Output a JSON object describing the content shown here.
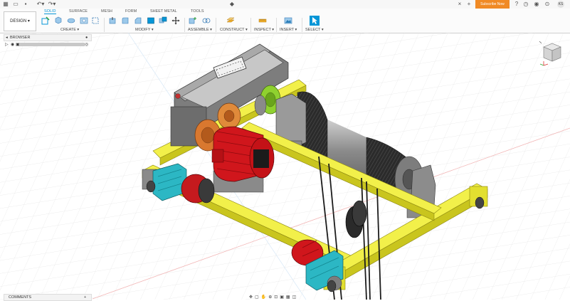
{
  "appbar": {
    "subscribe_label": "Subscribe Now",
    "user_initials": "KS"
  },
  "ribbon": {
    "workspace_label": "DESIGN ▾",
    "tabs": [
      "SOLID",
      "SURFACE",
      "MESH",
      "FORM",
      "SHEET METAL",
      "TOOLS"
    ],
    "active_tab": "SOLID",
    "groups": [
      "CREATE ▾",
      "MODIFY ▾",
      "ASSEMBLE ▾",
      "CONSTRUCT ▾",
      "INSPECT ▾",
      "INSERT ▾",
      "SELECT ▾"
    ]
  },
  "browser": {
    "title": "BROWSER"
  },
  "comments": {
    "title": "COMMENTS"
  },
  "colors": {
    "accent": "#0696d7",
    "subscribe": "#f08a24",
    "frame_yellow": "#e9e72f",
    "motor_red": "#d0161c",
    "brake_cyan": "#2cb7c4",
    "drum_dark": "#2b2b2b",
    "housing_gray": "#8a8a8a",
    "gear_orange": "#d9782f",
    "coupling_green": "#8fd12f"
  },
  "icons": [
    "pin-icon",
    "gear-icon",
    "undo-icon",
    "redo-icon",
    "close-icon",
    "plus-icon",
    "help-icon",
    "clock-icon",
    "bell-icon",
    "eye-icon"
  ]
}
